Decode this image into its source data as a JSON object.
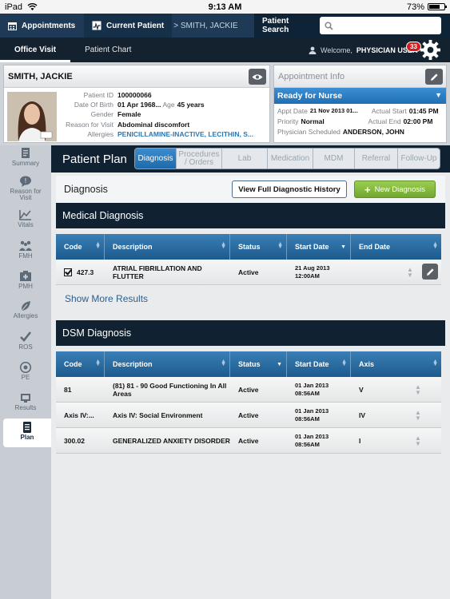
{
  "status_bar": {
    "device": "iPad",
    "time": "9:13 AM",
    "battery": "73%",
    "battery_fraction": 0.73
  },
  "top_nav": {
    "appointments": "Appointments",
    "current_patient": "Current Patient",
    "breadcrumb": "> SMITH, JACKIE",
    "patient_search_label": "Patient Search",
    "search_placeholder": ""
  },
  "sub_nav": {
    "tabs": [
      {
        "label": "Office Visit"
      },
      {
        "label": "Patient Chart"
      }
    ],
    "welcome_prefix": "Welcome,",
    "user": "PHYSICIAN USER",
    "notification_count": "33"
  },
  "patient": {
    "name": "SMITH, JACKIE",
    "fields": {
      "patient_id_label": "Patient ID",
      "patient_id": "100000066",
      "dob_label": "Date Of Birth",
      "dob": "01 Apr 1968...",
      "age_label": "Age",
      "age": "45 years",
      "gender_label": "Gender",
      "gender": "Female",
      "reason_label": "Reason for Visit",
      "reason": "Abdominal discomfort",
      "allergies_label": "Allergies",
      "allergies": "PENICILLAMINE-INACTIVE, LECITHIN, S..."
    }
  },
  "appointment": {
    "title": "Appointment Info",
    "status": "Ready for Nurse",
    "appt_date_label": "Appt Date",
    "appt_date": "21 Nov 2013 01...",
    "actual_start_label": "Actual Start",
    "actual_start": "01:45 PM",
    "priority_label": "Priority",
    "priority": "Normal",
    "actual_end_label": "Actual End",
    "actual_end": "02:00 PM",
    "physician_label": "Physician Scheduled",
    "physician": "ANDERSON, JOHN"
  },
  "sidebar": {
    "items": [
      {
        "label": "Summary"
      },
      {
        "label": "Reason for Visit"
      },
      {
        "label": "Vitals"
      },
      {
        "label": "FMH"
      },
      {
        "label": "PMH"
      },
      {
        "label": "Allergies"
      },
      {
        "label": "ROS"
      },
      {
        "label": "PE"
      },
      {
        "label": "Results"
      },
      {
        "label": "Plan"
      }
    ]
  },
  "plan": {
    "title": "Patient Plan",
    "tabs": [
      {
        "label": "Diagnosis"
      },
      {
        "label": "Procedures / Orders"
      },
      {
        "label": "Lab"
      },
      {
        "label": "Medication"
      },
      {
        "label": "MDM"
      },
      {
        "label": "Referral"
      },
      {
        "label": "Follow-Up"
      }
    ],
    "section_label": "Diagnosis",
    "history_button": "View Full Diagnostic History",
    "new_button": "New Diagnosis",
    "show_more": "Show More Results"
  },
  "medical": {
    "title": "Medical Diagnosis",
    "columns": [
      "Code",
      "Description",
      "Status",
      "Start Date",
      "End Date"
    ],
    "rows": [
      {
        "code": "427.3",
        "description": "ATRIAL FIBRILLATION AND FLUTTER",
        "status": "Active",
        "start": "21 Aug 2013 12:00AM",
        "end": ""
      }
    ]
  },
  "dsm": {
    "title": "DSM Diagnosis",
    "columns": [
      "Code",
      "Description",
      "Status",
      "Start Date",
      "Axis"
    ],
    "rows": [
      {
        "code": "81",
        "description": "(81) 81 - 90 Good Functioning In All Areas",
        "status": "Active",
        "start": "01 Jan 2013 08:56AM",
        "axis": "V"
      },
      {
        "code": "Axis IV:...",
        "description": "Axis IV: Social Environment",
        "status": "Active",
        "start": "01 Jan 2013 08:56AM",
        "axis": "IV"
      },
      {
        "code": "300.02",
        "description": "GENERALIZED ANXIETY DISORDER",
        "status": "Active",
        "start": "01 Jan 2013 08:56AM",
        "axis": "I"
      }
    ]
  }
}
